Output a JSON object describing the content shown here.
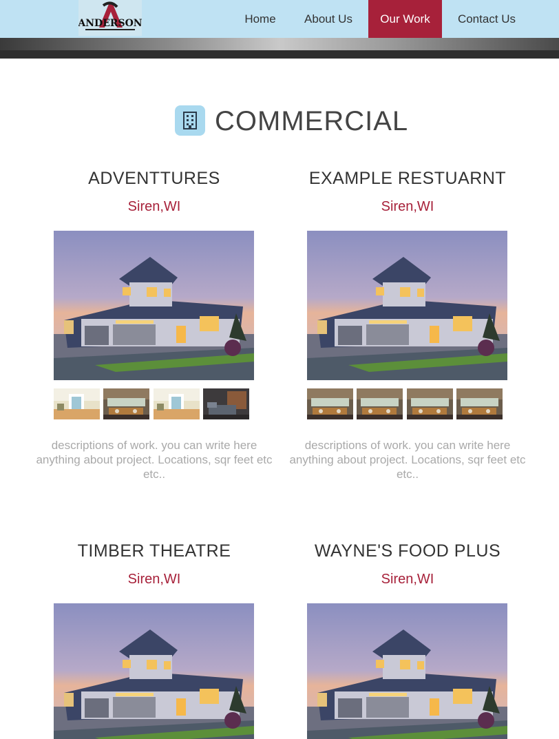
{
  "nav": {
    "logo_text": "ANDERSON",
    "items": [
      {
        "label": "Home"
      },
      {
        "label": "About Us"
      },
      {
        "label": "Our Work"
      },
      {
        "label": "Contact Us"
      }
    ]
  },
  "section": {
    "title": "COMMERCIAL",
    "icon": "building-icon"
  },
  "projects": [
    {
      "title": "ADVENTTURES",
      "location": "Siren,WI",
      "description": "descriptions of work. you can write here anything about project. Locations, sqr feet etc etc.."
    },
    {
      "title": "EXAMPLE RESTUARNT",
      "location": "Siren,WI",
      "description": "descriptions of work. you can write here anything about project. Locations, sqr feet etc etc.."
    },
    {
      "title": "TIMBER THEATRE",
      "location": "Siren,WI"
    },
    {
      "title": "WAYNE'S FOOD PLUS",
      "location": "Siren,WI"
    }
  ],
  "colors": {
    "accent": "#a7213a",
    "nav_bg": "#bfe2f3",
    "icon_bg": "#a9d9ef"
  }
}
